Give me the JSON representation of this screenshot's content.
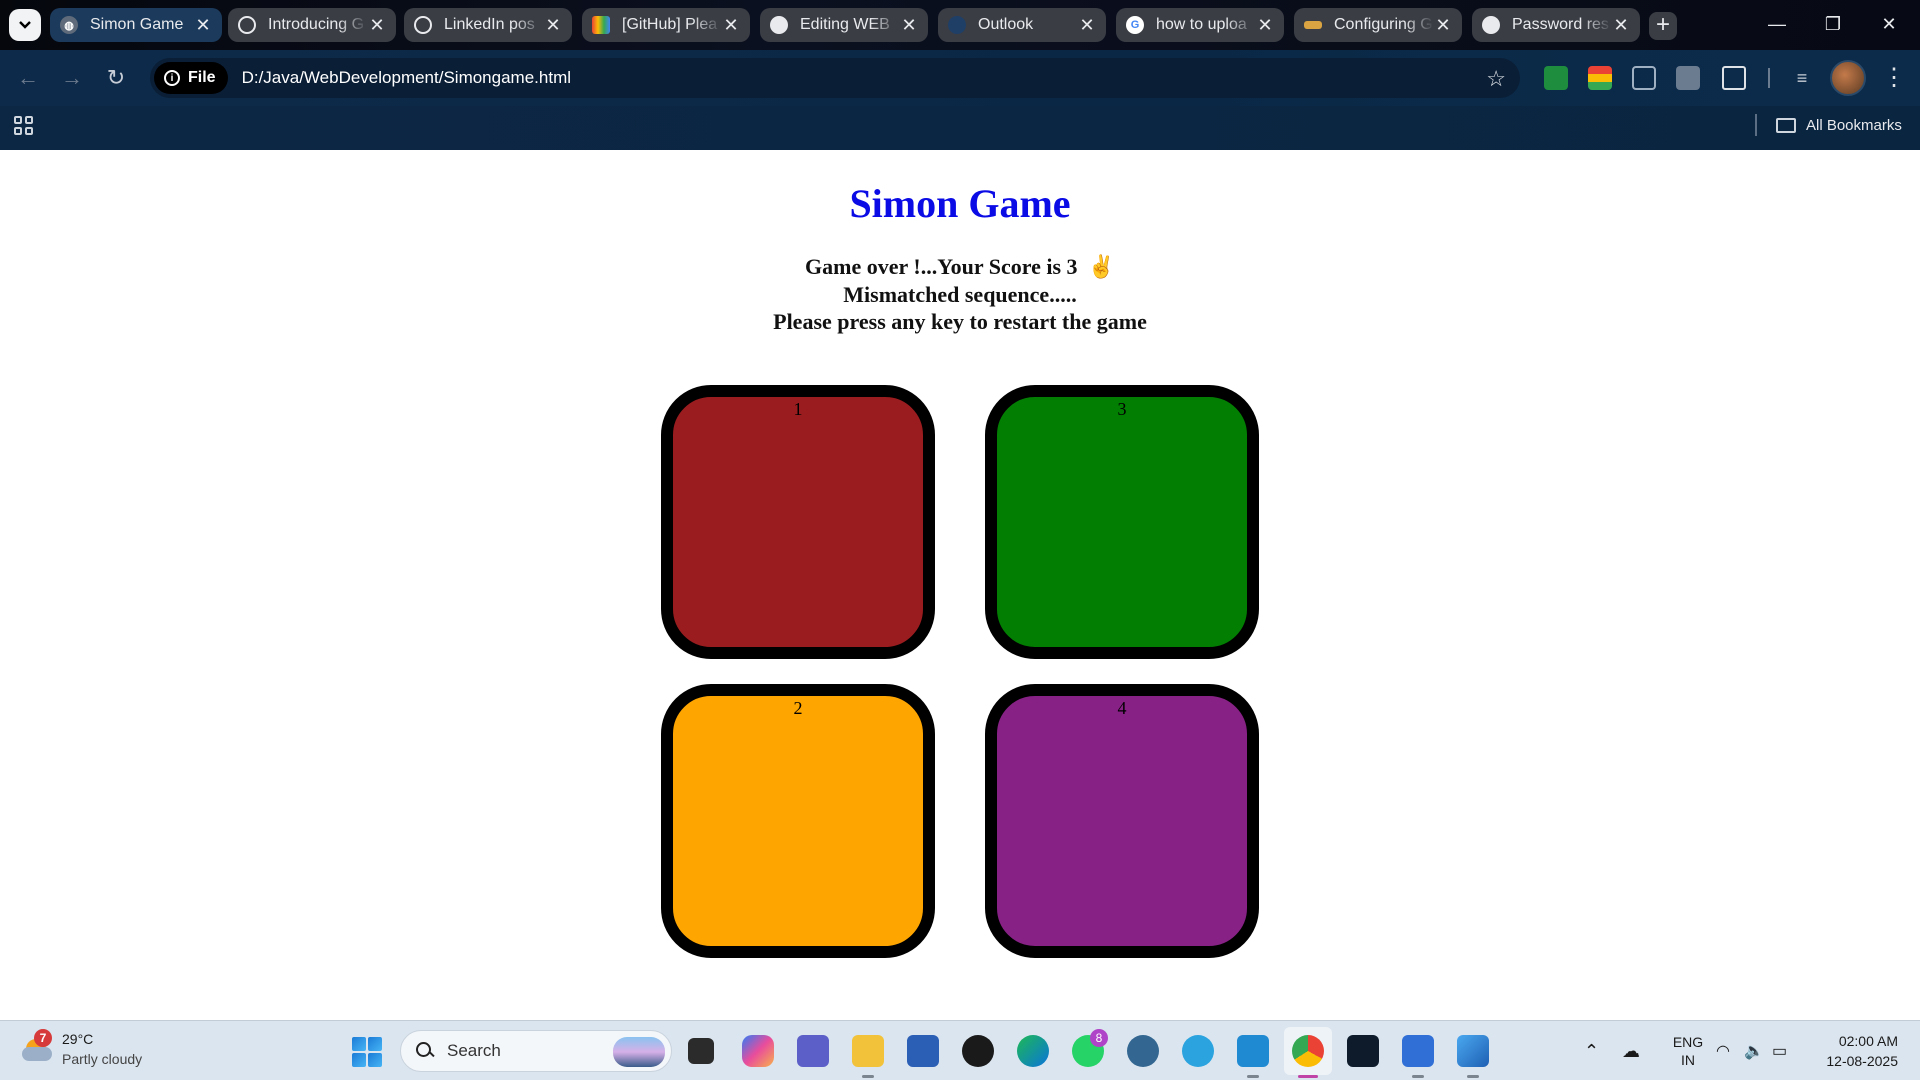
{
  "browser": {
    "tabs": [
      {
        "title": "Simon Game",
        "icon": "globe-icon",
        "active": true
      },
      {
        "title": "Introducing G",
        "icon": "openai-icon",
        "active": false
      },
      {
        "title": "LinkedIn pos",
        "icon": "openai-icon",
        "active": false
      },
      {
        "title": "[GitHub] Plea",
        "icon": "gmail-icon",
        "active": false
      },
      {
        "title": "Editing WEB",
        "icon": "github-icon",
        "active": false
      },
      {
        "title": "Outlook",
        "icon": "outlook-icon",
        "active": false
      },
      {
        "title": "how to uploa",
        "icon": "google-icon",
        "active": false
      },
      {
        "title": "Configuring G",
        "icon": "git-icon",
        "active": false
      },
      {
        "title": "Password res",
        "icon": "github-icon",
        "active": false
      }
    ],
    "new_tab": "+",
    "omnibox": {
      "chip": "File",
      "url": "D:/Java/WebDevelopment/Simongame.html"
    },
    "bookmarks": {
      "all_label": "All Bookmarks"
    }
  },
  "page": {
    "title": "Simon Game",
    "message_line1": "Game over !...Your Score is 3",
    "message_emoji": "✌",
    "message_line2": "Mismatched sequence.....",
    "message_line3": "Please press any key to restart the game",
    "pads": [
      {
        "label": "1",
        "color": "#9b1c1f"
      },
      {
        "label": "3",
        "color": "#027f02"
      },
      {
        "label": "2",
        "color": "#ffa500"
      },
      {
        "label": "4",
        "color": "#872186"
      }
    ],
    "colors": {
      "title": "#0b0be6"
    }
  },
  "taskbar": {
    "weather_badge": "7",
    "temperature": "29°C",
    "condition": "Partly cloudy",
    "search_label": "Search",
    "whatsapp_badge": "8",
    "language_line1": "ENG",
    "language_line2": "IN",
    "time": "02:00 AM",
    "date": "12-08-2025"
  }
}
